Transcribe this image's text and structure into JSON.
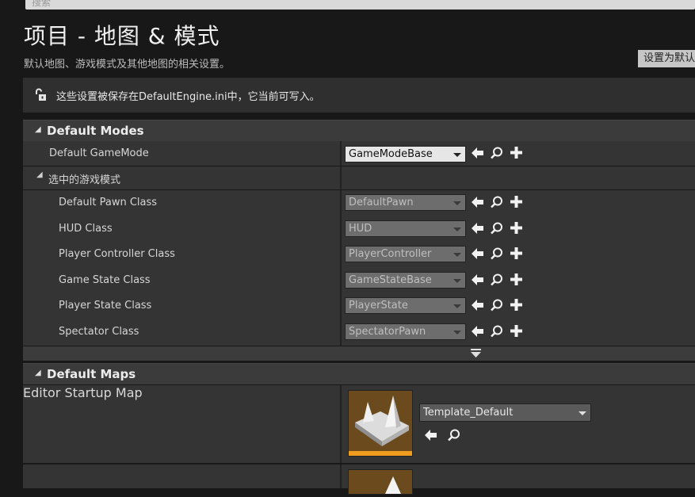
{
  "search": {
    "placeholder": "搜索"
  },
  "header": {
    "title": "项目 - 地图 & 模式",
    "subtitle": "默认地图、游戏模式及其他地图的相关设置。",
    "set_default_label": "设置为默认"
  },
  "notice": {
    "text": "这些设置被保存在DefaultEngine.ini中，它当前可写入。"
  },
  "default_modes": {
    "title": "Default Modes",
    "gamemode": {
      "label": "Default GameMode",
      "value": "GameModeBase"
    },
    "selected_gamemode": {
      "title": "选中的游戏模式",
      "rows": [
        {
          "label": "Default Pawn Class",
          "value": "DefaultPawn"
        },
        {
          "label": "HUD Class",
          "value": "HUD"
        },
        {
          "label": "Player Controller Class",
          "value": "PlayerController"
        },
        {
          "label": "Game State Class",
          "value": "GameStateBase"
        },
        {
          "label": "Player State Class",
          "value": "PlayerState"
        },
        {
          "label": "Spectator Class",
          "value": "SpectatorPawn"
        }
      ]
    }
  },
  "default_maps": {
    "title": "Default Maps",
    "editor_startup_map": {
      "label": "Editor Startup Map",
      "value": "Template_Default"
    }
  },
  "icons": [
    "lock-open-icon",
    "arrow-left-icon",
    "search-icon",
    "plus-icon",
    "chevron-down-icon",
    "map-thumbnail"
  ]
}
